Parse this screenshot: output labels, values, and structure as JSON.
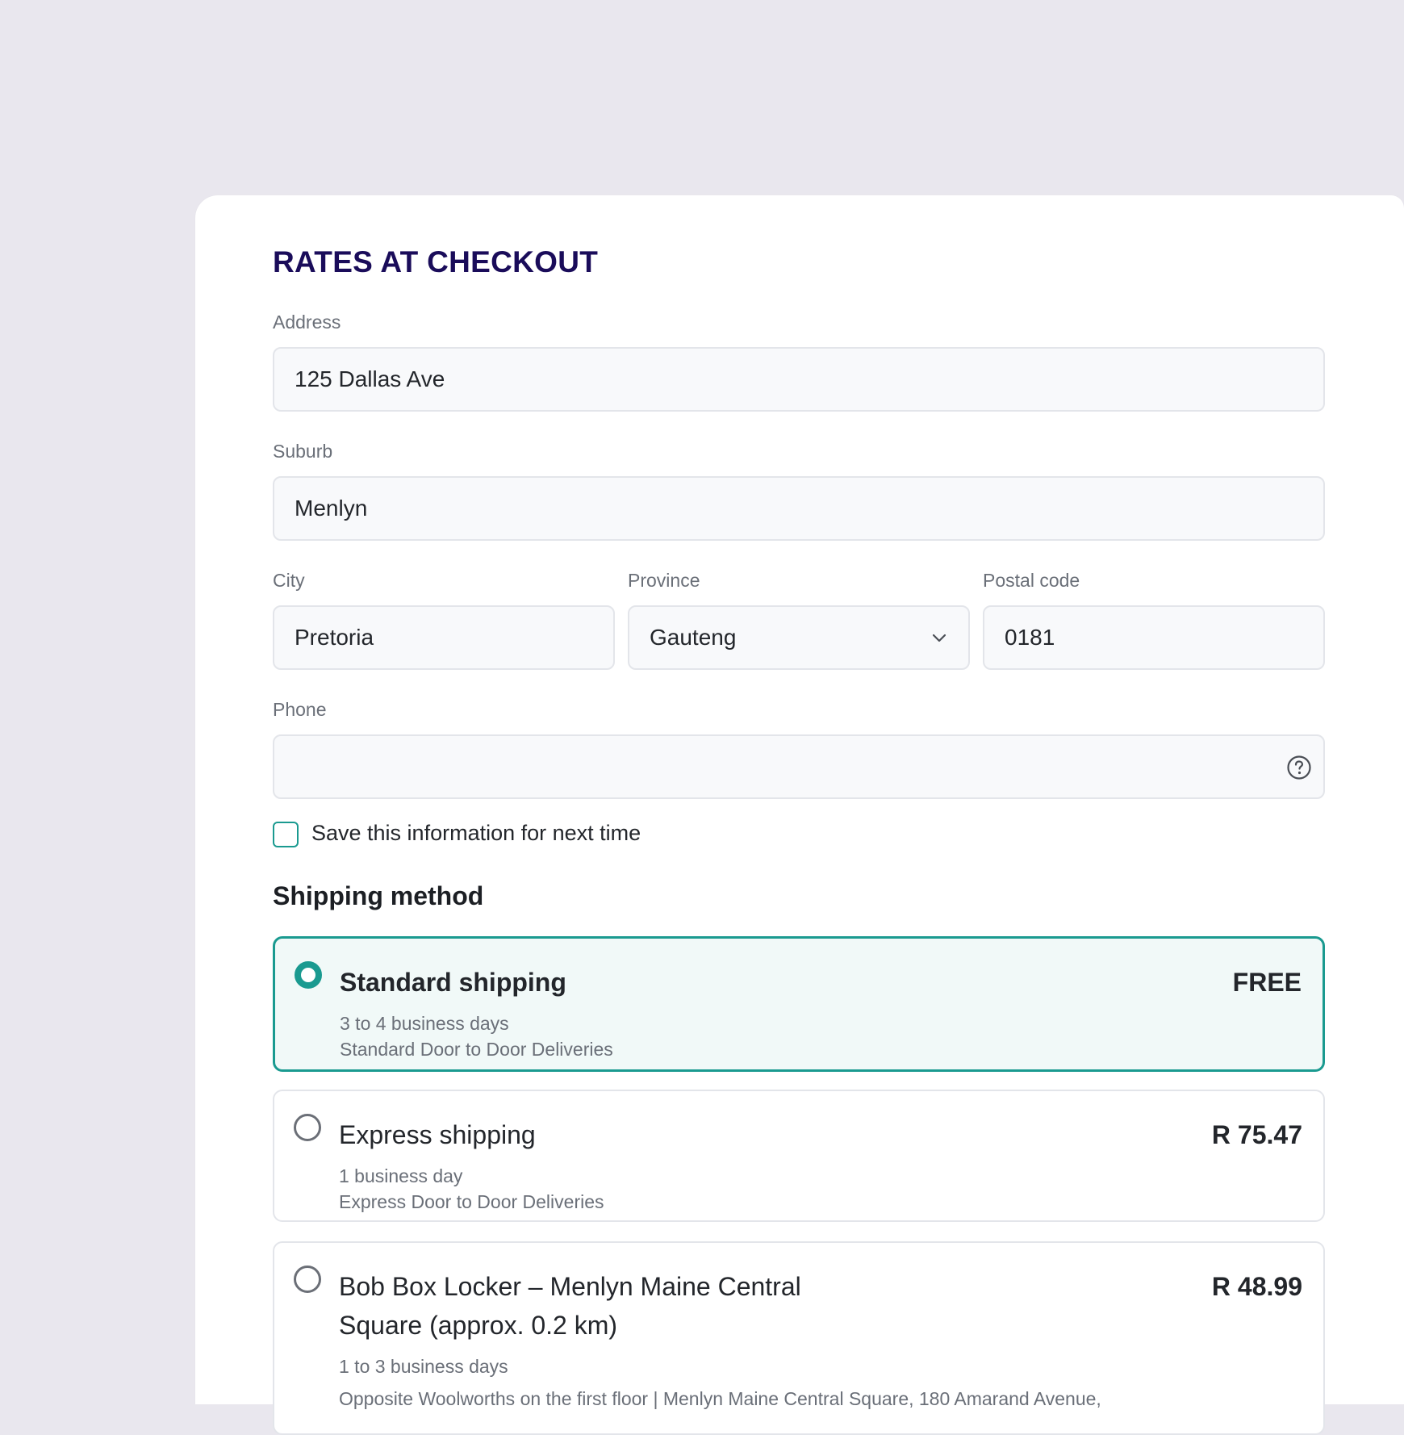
{
  "title": "RATES AT CHECKOUT",
  "form": {
    "address": {
      "label": "Address",
      "value": "125 Dallas Ave"
    },
    "suburb": {
      "label": "Suburb",
      "value": "Menlyn"
    },
    "city": {
      "label": "City",
      "value": "Pretoria"
    },
    "province": {
      "label": "Province",
      "value": "Gauteng"
    },
    "postal_code": {
      "label": "Postal code",
      "value": "0181"
    },
    "phone": {
      "label": "Phone",
      "value": ""
    },
    "save_info": {
      "label": "Save this information for next time",
      "checked": false
    }
  },
  "shipping": {
    "title": "Shipping method",
    "options": [
      {
        "name": "Standard shipping",
        "line1": "3 to 4 business days",
        "line2": "Standard Door to Door Deliveries",
        "price": "FREE",
        "selected": true
      },
      {
        "name": "Express shipping",
        "line1": "1 business day",
        "line2": "Express Door to Door Deliveries",
        "price": "R 75.47",
        "selected": false
      },
      {
        "name": "Bob Box Locker – Menlyn Maine Central Square (approx. 0.2 km)",
        "line1": "1 to 3 business days",
        "line2": "Opposite Woolworths on the first floor | Menlyn Maine Central Square, 180 Amarand Avenue,",
        "price": "R 48.99",
        "selected": false
      }
    ]
  },
  "colors": {
    "accent": "#1a9a90",
    "title": "#1a0c5a",
    "background": "#e9e7ee"
  },
  "icons": {
    "province_dropdown": "chevron-down-icon",
    "phone_help": "help-circle-icon"
  }
}
